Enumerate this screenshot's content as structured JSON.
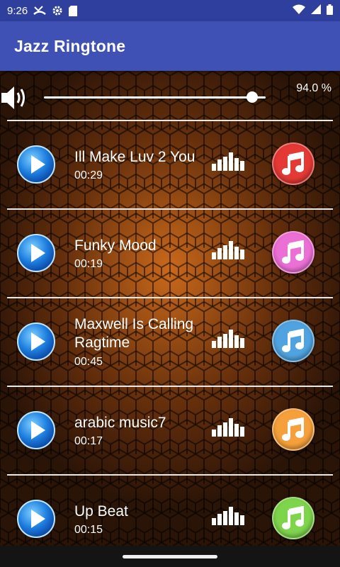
{
  "status_bar": {
    "time": "9:26",
    "left_icons": [
      "missed-call-icon",
      "settings-gear-icon",
      "sd-card-icon"
    ],
    "right_icons": [
      "wifi-icon",
      "cellular-signal-icon",
      "battery-icon"
    ]
  },
  "app_bar": {
    "title": "Jazz Ringtone"
  },
  "volume": {
    "level_percent": 94.0,
    "label": "94.0 %"
  },
  "songs": [
    {
      "title": "Ill Make Luv 2 You",
      "duration": "00:29",
      "color": "#e53935"
    },
    {
      "title": "Funky Mood",
      "duration": "00:19",
      "color": "#ec6fd6"
    },
    {
      "title": "Maxwell Is Calling Ragtime",
      "duration": "00:45",
      "color": "#4fa3e0"
    },
    {
      "title": "arabic music7",
      "duration": "00:17",
      "color": "#f5a03a"
    },
    {
      "title": "Up Beat",
      "duration": "00:15",
      "color": "#7ed44b"
    }
  ],
  "colors": {
    "app_bar": "#3f51b5",
    "status_bar": "#2f3f9e"
  }
}
